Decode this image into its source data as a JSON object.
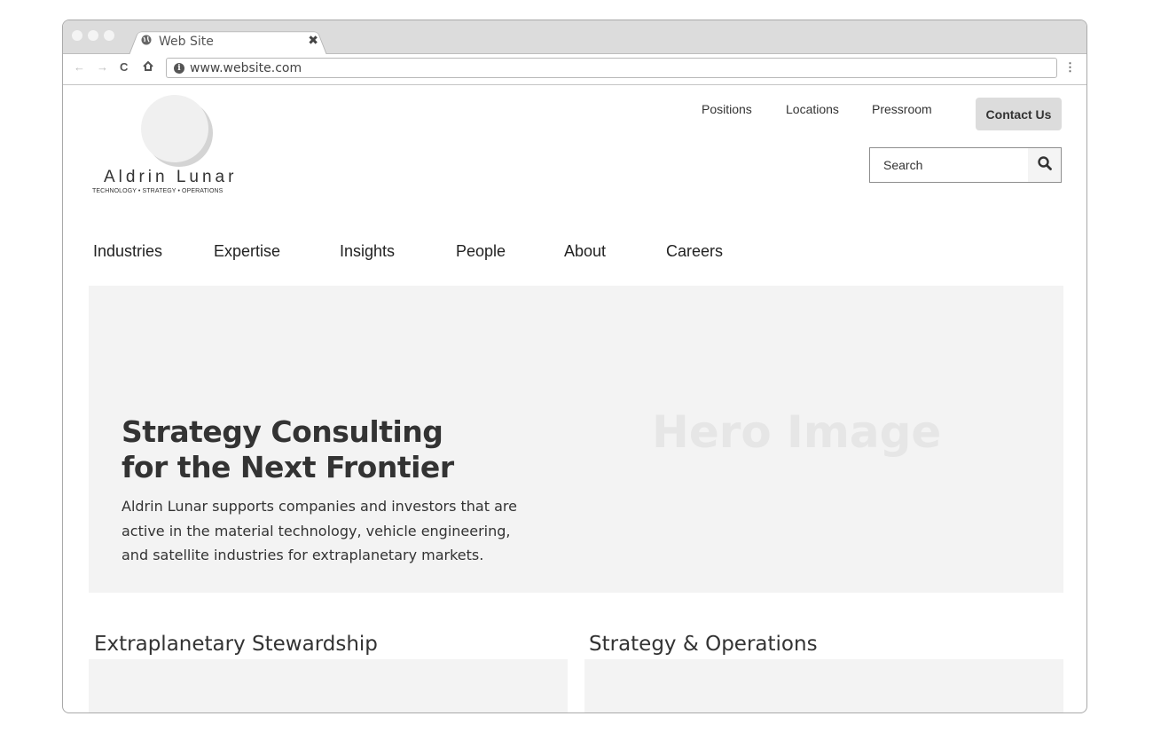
{
  "browser": {
    "tab_title": "Web Site",
    "url": "www.website.com"
  },
  "site": {
    "logo_name": "Aldrin Lunar",
    "logo_tagline": "TECHNOLOGY • STRATEGY • OPERATIONS"
  },
  "utility_nav": {
    "positions": "Positions",
    "locations": "Locations",
    "pressroom": "Pressroom",
    "contact": "Contact Us"
  },
  "search": {
    "placeholder": "Search"
  },
  "main_nav": {
    "items": [
      "Industries",
      "Expertise",
      "Insights",
      "People",
      "About",
      "Careers"
    ]
  },
  "hero": {
    "title": "Strategy Consulting for the Next Frontier",
    "description": "Aldrin Lunar supports companies and investors that are active in the material technology, vehicle engineering, and satellite industries for extraplanetary markets.",
    "image_label": "Hero Image"
  },
  "sections": {
    "left_title": "Extraplanetary Stewardship",
    "right_title": "Strategy & Operations"
  },
  "colors": {
    "hero_bg": "#f3f3f3",
    "button_bg": "#dcdcdc",
    "text": "#333333"
  }
}
